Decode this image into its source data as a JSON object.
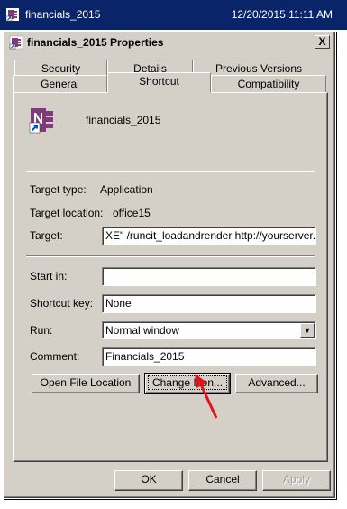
{
  "explorer_row": {
    "file_name": "financials_2015",
    "date_modified": "12/20/2015 11:11 AM"
  },
  "dialog": {
    "title": "financials_2015 Properties",
    "close_glyph": "X",
    "tabs_row1": [
      "Security",
      "Details",
      "Previous Versions"
    ],
    "tabs_row2": [
      "General",
      "Shortcut",
      "Compatibility"
    ],
    "active_tab": "Shortcut",
    "shortcut_name": "financials_2015",
    "target_type_label": "Target type:",
    "target_type_value": "Application",
    "target_location_label": "Target location:",
    "target_location_value": "office15",
    "target_label": "Target:",
    "target_value": "XE\" /runcit_loadandrender http://yourserver.com",
    "start_in_label": "Start in:",
    "start_in_value": "",
    "shortcut_key_label": "Shortcut key:",
    "shortcut_key_value": "None",
    "run_label": "Run:",
    "run_value": "Normal window",
    "comment_label": "Comment:",
    "comment_value": "Financials_2015",
    "open_file_location_label": "Open File Location",
    "change_icon_label": "Change Icon...",
    "advanced_label": "Advanced...",
    "ok_label": "OK",
    "cancel_label": "Cancel",
    "apply_label": "Apply"
  },
  "icons": {
    "file_icon": "onenote-file-icon",
    "shortcut_icon": "onenote-shortcut-icon",
    "annotation": "red-arrow"
  },
  "colors": {
    "selection": "#0a246a",
    "dialog_face": "#d4d0c8",
    "annotation_arrow": "#e0151b",
    "onenote_purple": "#80397b"
  }
}
